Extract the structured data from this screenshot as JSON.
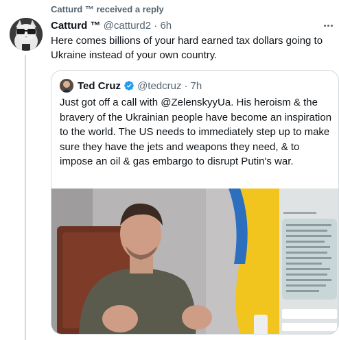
{
  "context": {
    "text": "Catturd ™ received a reply"
  },
  "tweet": {
    "author_name": "Catturd ™",
    "handle": "@catturd2",
    "separator": "·",
    "time": "6h",
    "text": "Here comes billions of your hard earned tax dollars going to Ukraine instead of your own country."
  },
  "quoted": {
    "author_name": "Ted Cruz",
    "handle": "@tedcruz",
    "separator": "·",
    "time": "7h",
    "text": "Just got off a call with @ZelenskyyUa. His heroism & the bravery of the Ukrainian people have become an inspiration to the world. The US needs to immediately step up to make sure they have the jets and weapons they need, & to impose an oil & gas embargo to disrupt Putin's war."
  },
  "colors": {
    "verified": "#1d9bf0",
    "muted": "#536471",
    "border": "#cfd9de"
  },
  "icons": {
    "verified": "verified-badge-icon",
    "more": "more-options-icon"
  }
}
